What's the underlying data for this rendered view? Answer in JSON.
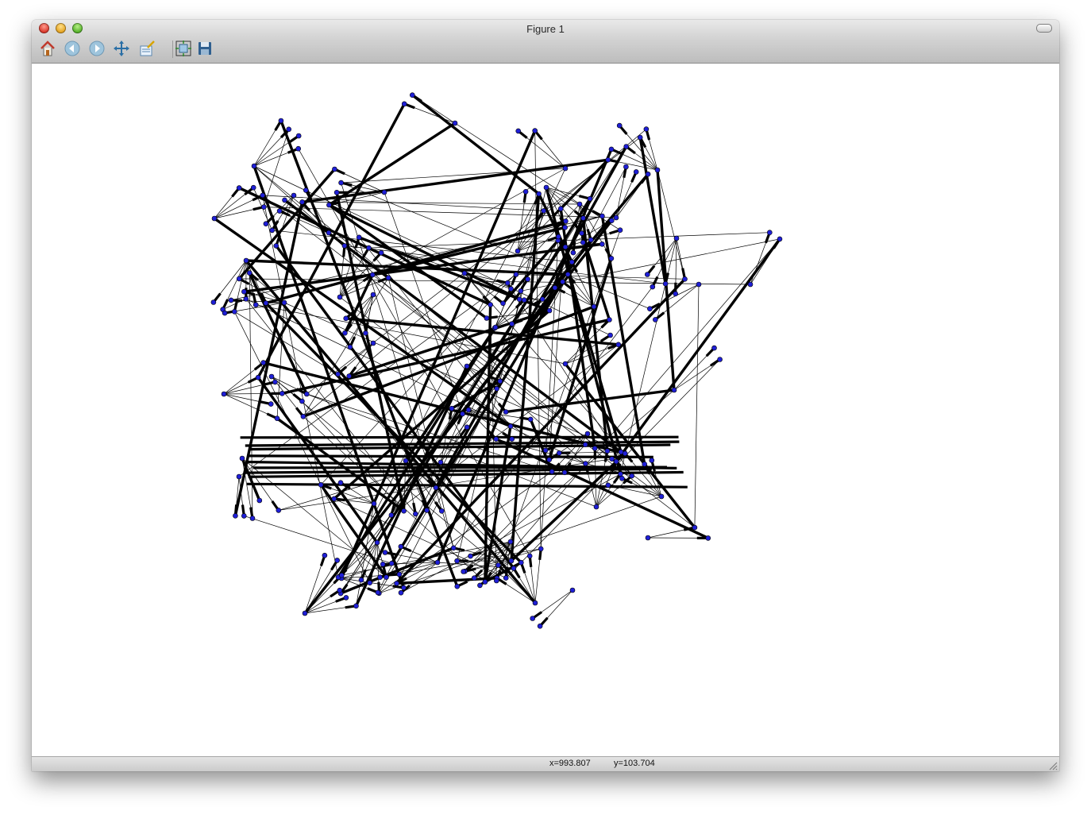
{
  "window": {
    "title": "Figure 1"
  },
  "toolbar": {
    "buttons": [
      {
        "name": "home-button",
        "icon": "home-icon"
      },
      {
        "name": "back-button",
        "icon": "back-arrow-icon"
      },
      {
        "name": "forward-button",
        "icon": "forward-arrow-icon"
      },
      {
        "name": "pan-button",
        "icon": "move-icon"
      },
      {
        "name": "zoom-button",
        "icon": "zoom-rect-icon"
      },
      {
        "name": "subplots-button",
        "icon": "subplots-icon"
      },
      {
        "name": "save-button",
        "icon": "floppy-disk-icon"
      }
    ]
  },
  "status": {
    "x": "x=993.807",
    "y": "y=103.704"
  },
  "colors": {
    "node": "#1f1fd6",
    "edge": "#000000"
  }
}
